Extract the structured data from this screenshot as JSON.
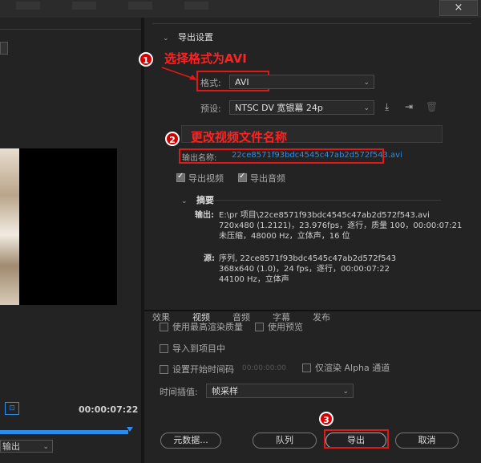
{
  "window": {
    "close_glyph": "×"
  },
  "source": {
    "timecode": "00:00:07:22",
    "output_dropdown": "输出",
    "tc_icon": "⊡"
  },
  "export_settings": {
    "section_title": "导出设置",
    "format_label": "格式:",
    "format_value": "AVI",
    "preset_label": "预设:",
    "preset_value": "NTSC DV 宽银幕 24p",
    "output_name_label": "输出名称:",
    "output_name_value": "22ce8571f93bdc4545c47ab2d572f543.avi",
    "export_video": "导出视频",
    "export_audio": "导出音频",
    "summary_title": "摘要",
    "output_head": "输出:",
    "output_lines": [
      "E:\\pr 项目\\22ce8571f93bdc4545c47ab2d572f543.avi",
      "720x480 (1.2121)，23.976fps，逐行，质量 100，00:00:07:21",
      "未压缩，48000 Hz，立体声，16 位"
    ],
    "source_head": "源:",
    "source_lines": [
      "序列, 22ce8571f93bdc4545c47ab2d572f543",
      "368x640 (1.0)，24 fps，逐行，00:00:07:22",
      "44100 Hz，立体声"
    ]
  },
  "annotations": {
    "step1": "选择格式为AVI",
    "step2": "更改视频文件名称",
    "badge1": "1",
    "badge2": "2",
    "badge3": "3"
  },
  "tabs": [
    "效果",
    "视频",
    "音频",
    "字幕",
    "发布"
  ],
  "options": {
    "max_render_quality": "使用最高渲染质量",
    "use_previews": "使用预览",
    "import_into_project": "导入到项目中",
    "set_start_timecode": "设置开始时间码",
    "start_timecode_value": "00:00:00:00",
    "render_alpha_only": "仅渲染 Alpha 通道",
    "time_interpolation_label": "时间插值:",
    "time_interpolation_value": "帧采样"
  },
  "buttons": {
    "metadata": "元数据...",
    "queue": "队列",
    "export": "导出",
    "cancel": "取消"
  },
  "colors": {
    "accent_blue": "#2d8ceb",
    "annotation_red": "#e01818"
  }
}
